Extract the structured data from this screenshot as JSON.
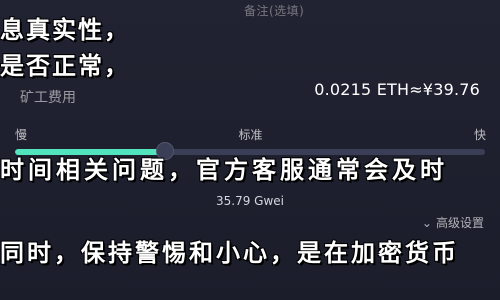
{
  "fee": {
    "header_muted": "备注(选填)",
    "label": "矿工费用",
    "value": "0.0215 ETH≈¥39.76",
    "speed": {
      "slow": "慢",
      "standard": "标准",
      "fast": "快"
    },
    "slider_level": 0.32,
    "gwei": "35.79 Gwei",
    "advanced": "高级设置",
    "advanced_icon": "chevron-down-icon"
  },
  "overlay": {
    "line1": "息真实性，",
    "line2": "是否正常，",
    "line3": "时间相关问题，官方客服通常会及时",
    "line4": "同时，保持警惕和小心，是在加密货币"
  }
}
